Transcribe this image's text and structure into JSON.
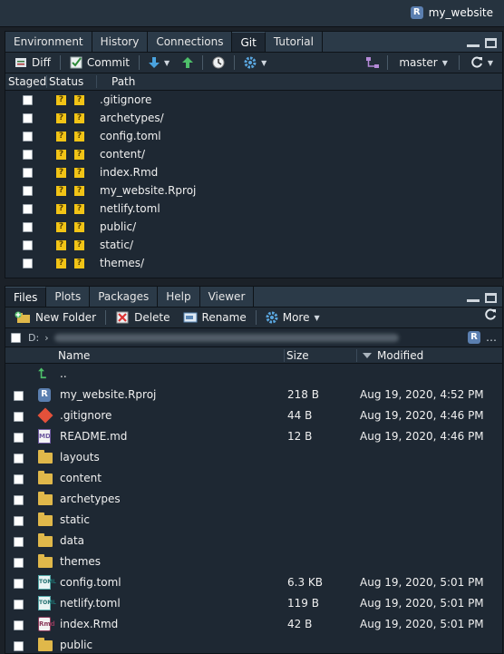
{
  "project": {
    "name": "my_website"
  },
  "git_pane": {
    "tabs": [
      "Environment",
      "History",
      "Connections",
      "Git",
      "Tutorial"
    ],
    "active_tab": "Git",
    "toolbar": {
      "diff": "Diff",
      "commit": "Commit",
      "branch": "master"
    },
    "columns": {
      "staged": "Staged",
      "status": "Status",
      "path": "Path"
    },
    "rows": [
      {
        "status": "?",
        "path": ".gitignore"
      },
      {
        "status": "?",
        "path": "archetypes/"
      },
      {
        "status": "?",
        "path": "config.toml"
      },
      {
        "status": "?",
        "path": "content/"
      },
      {
        "status": "?",
        "path": "index.Rmd"
      },
      {
        "status": "?",
        "path": "my_website.Rproj"
      },
      {
        "status": "?",
        "path": "netlify.toml"
      },
      {
        "status": "?",
        "path": "public/"
      },
      {
        "status": "?",
        "path": "static/"
      },
      {
        "status": "?",
        "path": "themes/"
      }
    ]
  },
  "files_pane": {
    "tabs": [
      "Files",
      "Plots",
      "Packages",
      "Help",
      "Viewer"
    ],
    "active_tab": "Files",
    "toolbar": {
      "new_folder": "New Folder",
      "delete": "Delete",
      "rename": "Rename",
      "more": "More"
    },
    "breadcrumb_root": "D:",
    "columns": {
      "name": "Name",
      "size": "Size",
      "modified": "Modified"
    },
    "parent_dir": "..",
    "rows": [
      {
        "icon": "rproj-icon",
        "name": "my_website.Rproj",
        "size": "218 B",
        "modified": "Aug 19, 2020, 4:52 PM"
      },
      {
        "icon": "git-icon",
        "name": ".gitignore",
        "size": "44 B",
        "modified": "Aug 19, 2020, 4:46 PM"
      },
      {
        "icon": "markdown-icon",
        "name": "README.md",
        "size": "12 B",
        "modified": "Aug 19, 2020, 4:46 PM"
      },
      {
        "icon": "folder-icon",
        "name": "layouts",
        "size": "",
        "modified": ""
      },
      {
        "icon": "folder-icon",
        "name": "content",
        "size": "",
        "modified": ""
      },
      {
        "icon": "folder-icon",
        "name": "archetypes",
        "size": "",
        "modified": ""
      },
      {
        "icon": "folder-icon",
        "name": "static",
        "size": "",
        "modified": ""
      },
      {
        "icon": "folder-icon",
        "name": "data",
        "size": "",
        "modified": ""
      },
      {
        "icon": "folder-icon",
        "name": "themes",
        "size": "",
        "modified": ""
      },
      {
        "icon": "toml-icon",
        "name": "config.toml",
        "size": "6.3 KB",
        "modified": "Aug 19, 2020, 5:01 PM"
      },
      {
        "icon": "toml-icon",
        "name": "netlify.toml",
        "size": "119 B",
        "modified": "Aug 19, 2020, 5:01 PM"
      },
      {
        "icon": "rmd-icon",
        "name": "index.Rmd",
        "size": "42 B",
        "modified": "Aug 19, 2020, 5:01 PM"
      },
      {
        "icon": "folder-icon",
        "name": "public",
        "size": "",
        "modified": ""
      }
    ]
  },
  "colors": {
    "status_untracked": "#f2c416",
    "folder": "#e0b84a",
    "background": "#1e2833"
  }
}
